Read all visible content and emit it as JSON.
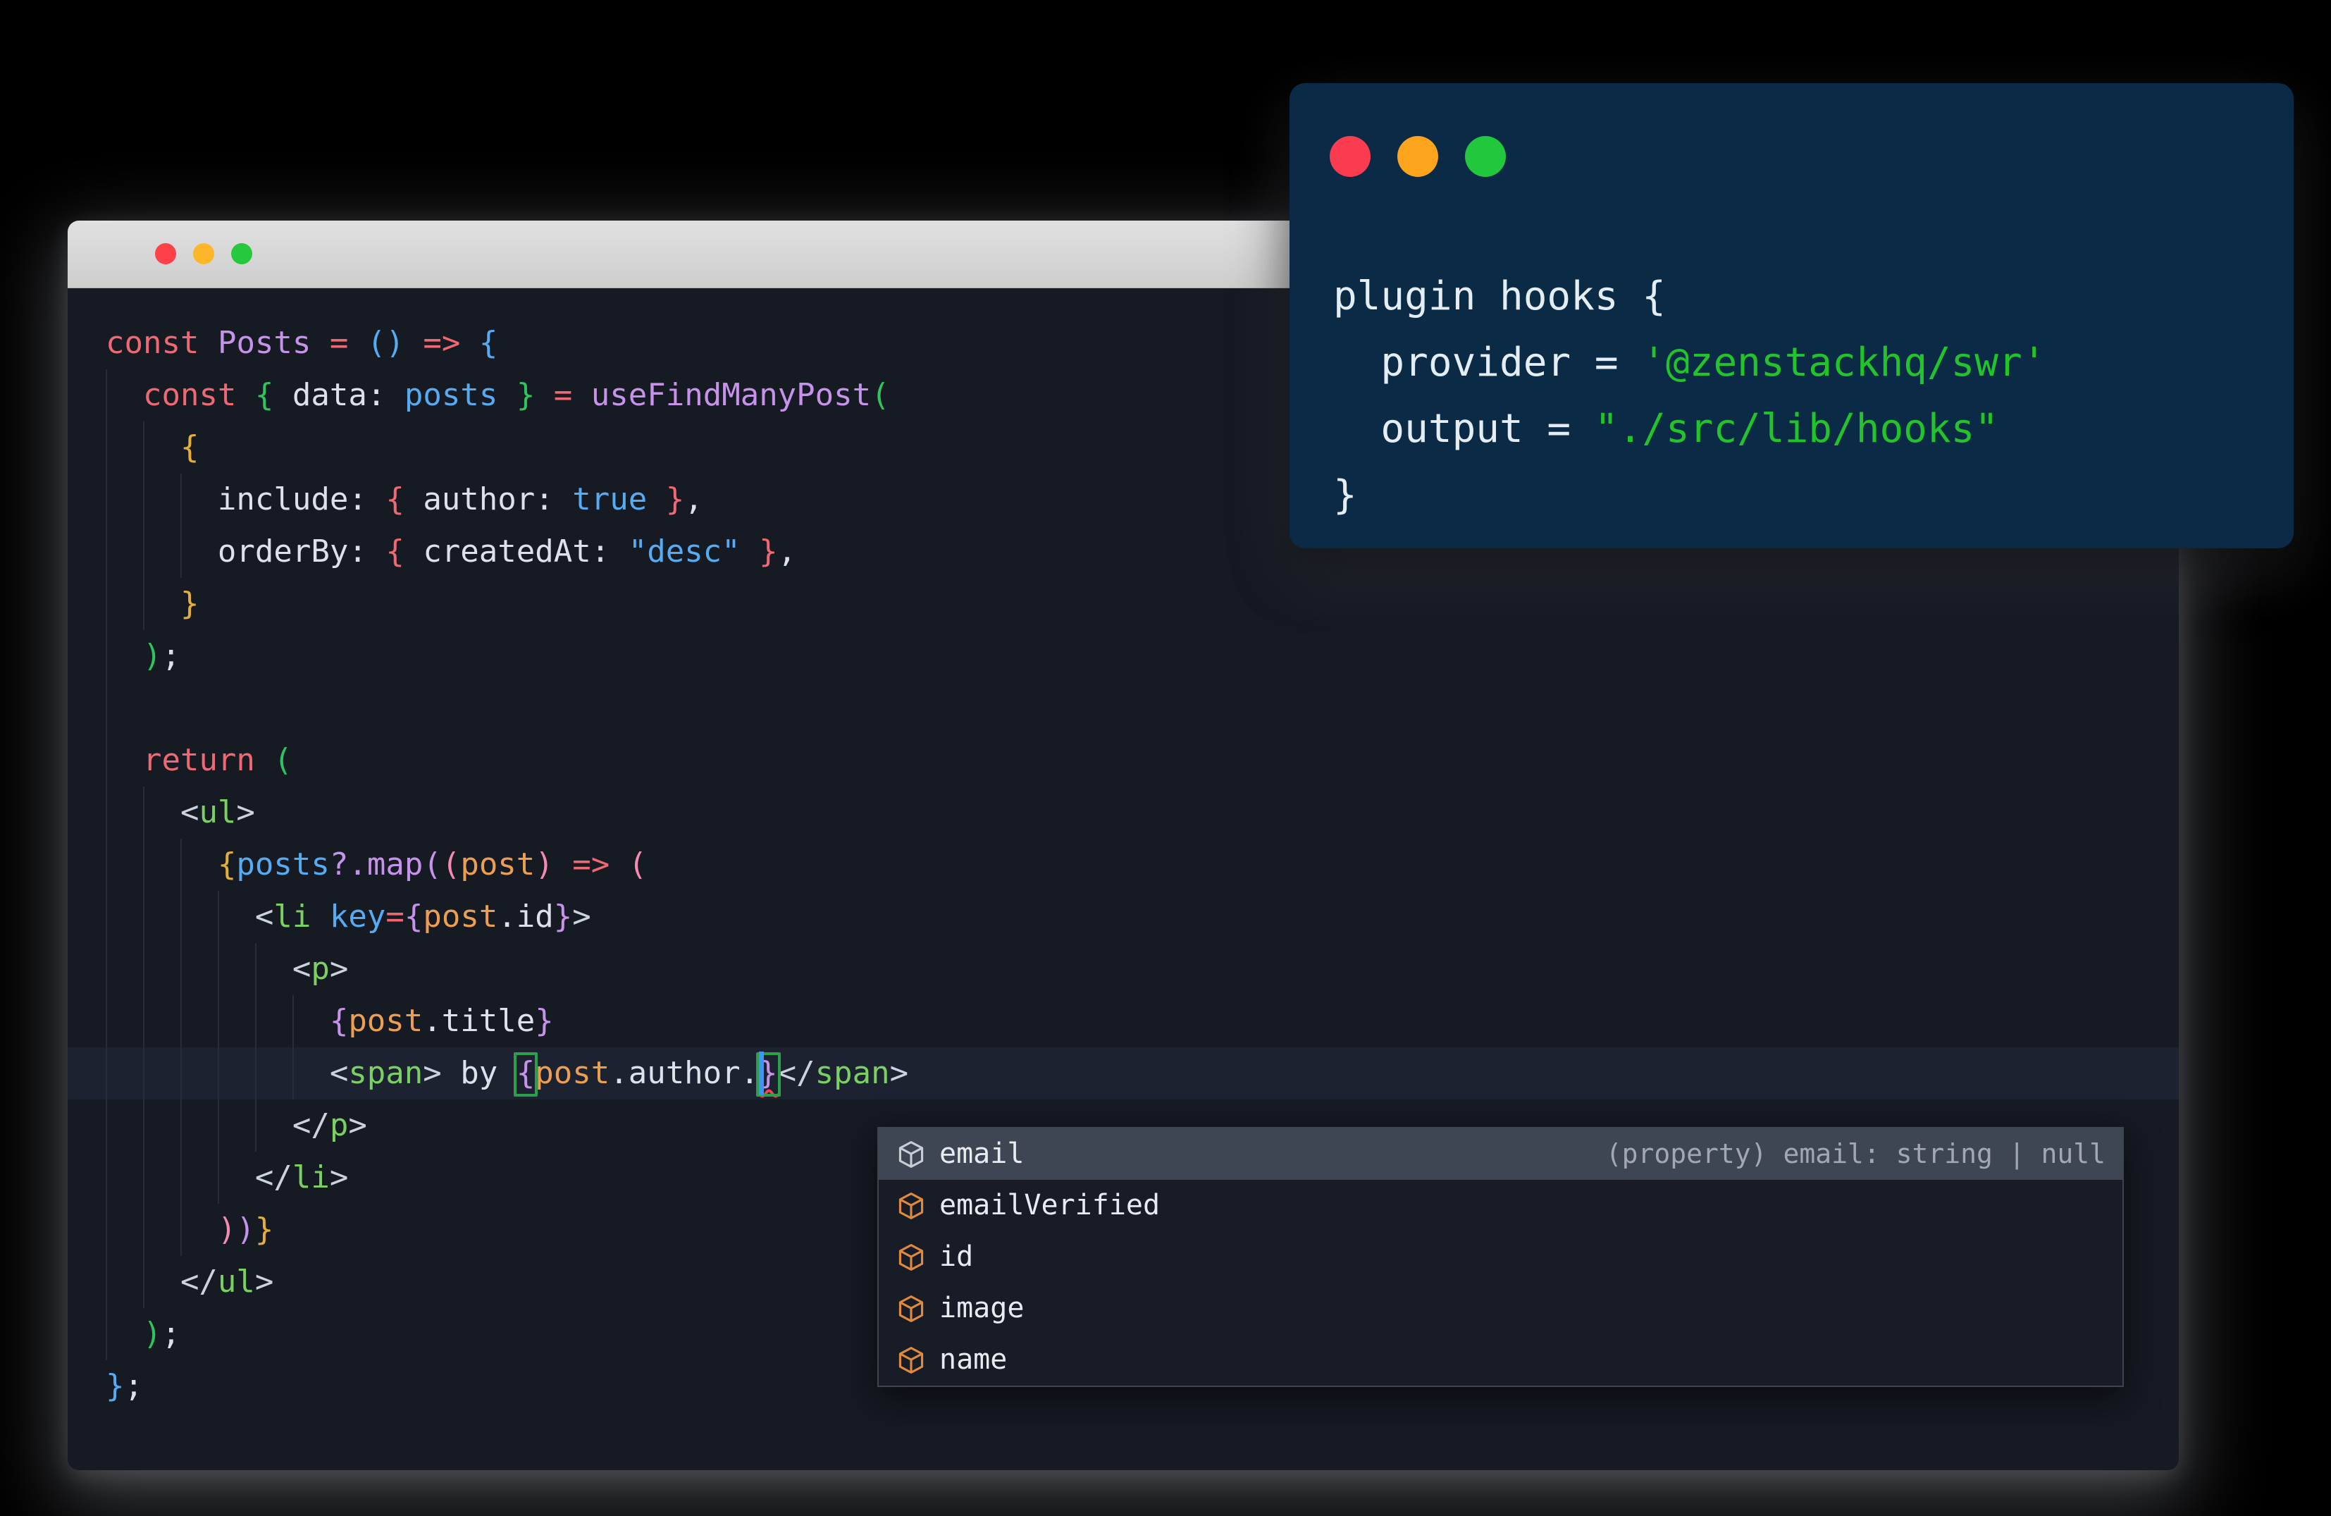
{
  "palette": {
    "kw": "#ee6973",
    "purple": "#c793ea",
    "blue": "#57abf2",
    "green": "#31c35e",
    "tag": "#7bcf63",
    "gold": "#e3af3a",
    "orange": "#ec9e53",
    "pink": "#f48bb2",
    "white": "#dde2ea",
    "angle": "#ccd3dd",
    "string_green": "#23c32b",
    "plugin_text": "#e4ecf4",
    "icon_gray": "#c9ced6",
    "icon_orange": "#e08a3e",
    "cursor_blue": "#4095f2",
    "bracket_match_green": "#2d9e4b",
    "error_red": "#ef4458"
  },
  "editor_window": {
    "traffic_lights": {
      "close": "#fc4149",
      "minimize": "#fdb62a",
      "zoom": "#27c93c"
    },
    "code_lines": [
      {
        "indent": 0,
        "tokens": [
          [
            "const ",
            "kw"
          ],
          [
            "Posts ",
            "purple"
          ],
          [
            "= ",
            "kw"
          ],
          [
            "() ",
            "blue"
          ],
          [
            "=> ",
            "kw"
          ],
          [
            "{",
            "blue"
          ]
        ]
      },
      {
        "indent": 1,
        "tokens": [
          [
            "const ",
            "kw"
          ],
          [
            "{ ",
            "green"
          ],
          [
            "data: ",
            "white"
          ],
          [
            "posts ",
            "blue"
          ],
          [
            "} ",
            "green"
          ],
          [
            "= ",
            "kw"
          ],
          [
            "useFindManyPost",
            "purple"
          ],
          [
            "(",
            "green"
          ]
        ]
      },
      {
        "indent": 2,
        "tokens": [
          [
            "{",
            "gold"
          ]
        ]
      },
      {
        "indent": 3,
        "tokens": [
          [
            "include: ",
            "white"
          ],
          [
            "{ ",
            "kw"
          ],
          [
            "author: ",
            "white"
          ],
          [
            "true ",
            "blue"
          ],
          [
            "}",
            "kw"
          ],
          [
            ",",
            "white"
          ]
        ]
      },
      {
        "indent": 3,
        "tokens": [
          [
            "orderBy: ",
            "white"
          ],
          [
            "{ ",
            "kw"
          ],
          [
            "createdAt: ",
            "white"
          ],
          [
            "\"desc\" ",
            "blue"
          ],
          [
            "}",
            "kw"
          ],
          [
            ",",
            "white"
          ]
        ]
      },
      {
        "indent": 2,
        "tokens": [
          [
            "}",
            "gold"
          ]
        ]
      },
      {
        "indent": 1,
        "tokens": [
          [
            ")",
            "green"
          ],
          [
            ";",
            "white"
          ]
        ]
      },
      {
        "indent": 1,
        "tokens": []
      },
      {
        "indent": 1,
        "tokens": [
          [
            "return ",
            "kw"
          ],
          [
            "(",
            "green"
          ]
        ]
      },
      {
        "indent": 2,
        "tokens": [
          [
            "<",
            "angle"
          ],
          [
            "ul",
            "tag"
          ],
          [
            ">",
            "angle"
          ]
        ]
      },
      {
        "indent": 3,
        "tokens": [
          [
            "{",
            "gold"
          ],
          [
            "posts",
            "blue"
          ],
          [
            "?.",
            "purple"
          ],
          [
            "map",
            "purple"
          ],
          [
            "(",
            "purple"
          ],
          [
            "(",
            "pink"
          ],
          [
            "post",
            "orange"
          ],
          [
            ")",
            "pink"
          ],
          [
            " ",
            "white"
          ],
          [
            "=> ",
            "kw"
          ],
          [
            "(",
            "pink"
          ]
        ]
      },
      {
        "indent": 4,
        "tokens": [
          [
            "<",
            "angle"
          ],
          [
            "li ",
            "tag"
          ],
          [
            "key",
            "blue"
          ],
          [
            "=",
            "kw"
          ],
          [
            "{",
            "purple"
          ],
          [
            "post",
            "orange"
          ],
          [
            ".id",
            "white"
          ],
          [
            "}",
            "purple"
          ],
          [
            ">",
            "angle"
          ]
        ]
      },
      {
        "indent": 5,
        "tokens": [
          [
            "<",
            "angle"
          ],
          [
            "p",
            "tag"
          ],
          [
            ">",
            "angle"
          ]
        ]
      },
      {
        "indent": 6,
        "tokens": [
          [
            "{",
            "purple"
          ],
          [
            "post",
            "orange"
          ],
          [
            ".title",
            "white"
          ],
          [
            "}",
            "purple"
          ]
        ]
      },
      {
        "indent": 6,
        "active": true,
        "tokens": [
          [
            "<",
            "angle"
          ],
          [
            "span",
            "tag"
          ],
          [
            "> ",
            "angle"
          ],
          [
            "by ",
            "white"
          ],
          [
            "{",
            "purple",
            "m"
          ],
          [
            "post",
            "orange"
          ],
          [
            ".author.",
            "white"
          ],
          [
            "}",
            "purple",
            "ms"
          ],
          [
            "</",
            "angle"
          ],
          [
            "span",
            "tag"
          ],
          [
            ">",
            "angle"
          ]
        ]
      },
      {
        "indent": 5,
        "tokens": [
          [
            "</",
            "angle"
          ],
          [
            "p",
            "tag"
          ],
          [
            ">",
            "angle"
          ]
        ]
      },
      {
        "indent": 4,
        "tokens": [
          [
            "</",
            "angle"
          ],
          [
            "li",
            "tag"
          ],
          [
            ">",
            "angle"
          ]
        ]
      },
      {
        "indent": 3,
        "tokens": [
          [
            ")",
            "pink"
          ],
          [
            ")",
            "purple"
          ],
          [
            "}",
            "gold"
          ]
        ]
      },
      {
        "indent": 2,
        "tokens": [
          [
            "</",
            "angle"
          ],
          [
            "ul",
            "tag"
          ],
          [
            ">",
            "angle"
          ]
        ]
      },
      {
        "indent": 1,
        "tokens": [
          [
            ")",
            "green"
          ],
          [
            ";",
            "white"
          ]
        ]
      },
      {
        "indent": 0,
        "tokens": [
          [
            "}",
            "blue"
          ],
          [
            ";",
            "white"
          ]
        ]
      }
    ],
    "autocomplete": {
      "items": [
        {
          "label": "email",
          "icon": "gray",
          "selected": true,
          "hint": "(property) email: string | null"
        },
        {
          "label": "emailVerified",
          "icon": "orange",
          "selected": false,
          "hint": ""
        },
        {
          "label": "id",
          "icon": "orange",
          "selected": false,
          "hint": ""
        },
        {
          "label": "image",
          "icon": "orange",
          "selected": false,
          "hint": ""
        },
        {
          "label": "name",
          "icon": "orange",
          "selected": false,
          "hint": ""
        }
      ]
    }
  },
  "plugin_window": {
    "traffic_lights": {
      "close": "#fb3b4f",
      "minimize": "#fca41c",
      "zoom": "#21c83d"
    },
    "code_lines": [
      [
        [
          "plugin hooks {",
          "plugin_text"
        ]
      ],
      [
        [
          "  provider = ",
          "plugin_text"
        ],
        [
          "'@zenstackhq/swr'",
          "string_green"
        ]
      ],
      [
        [
          "  output = ",
          "plugin_text"
        ],
        [
          "\"./src/lib/hooks\"",
          "string_green"
        ]
      ],
      [
        [
          "}",
          "plugin_text"
        ]
      ]
    ]
  }
}
